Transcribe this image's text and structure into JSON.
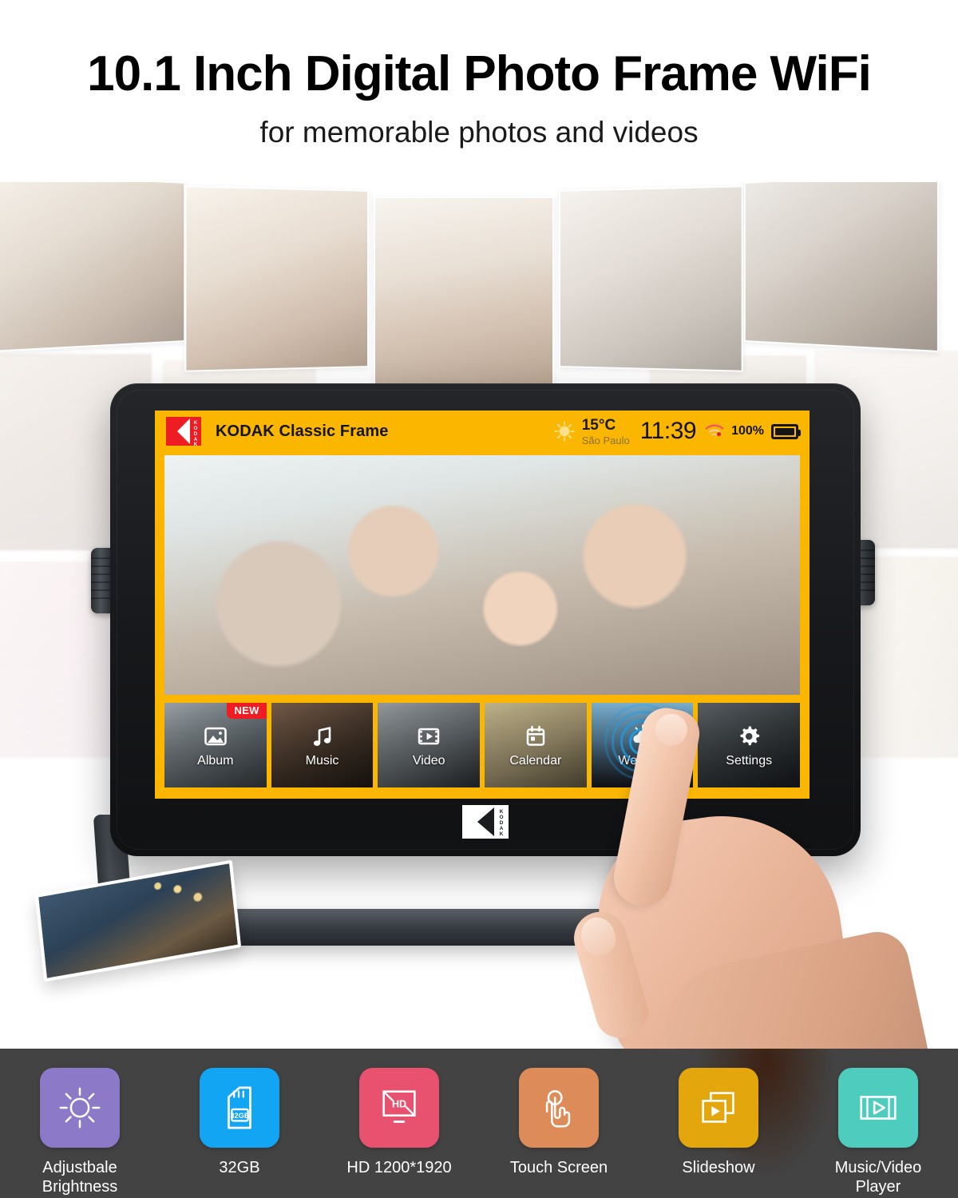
{
  "hero": {
    "title": "10.1 Inch Digital Photo Frame WiFi",
    "subtitle": "for memorable photos and videos"
  },
  "device": {
    "brand_logo_name": "kodak-logo",
    "chin_logo_name": "kodak-logo-white",
    "screen": {
      "statusbar": {
        "app_title": "KODAK Classic Frame",
        "weather": {
          "icon": "sun-icon",
          "temperature": "15°C",
          "location": "São Paulo"
        },
        "clock": "11:39",
        "wifi_icon": "wifi-icon",
        "battery_percent": "100%",
        "battery_icon": "battery-full-icon"
      },
      "apps": [
        {
          "label": "Album",
          "icon": "image-icon",
          "badge": "NEW"
        },
        {
          "label": "Music",
          "icon": "music-note-icon",
          "badge": ""
        },
        {
          "label": "Video",
          "icon": "film-play-icon",
          "badge": ""
        },
        {
          "label": "Calendar",
          "icon": "calendar-icon",
          "badge": ""
        },
        {
          "label": "Weather",
          "icon": "sun-cloud-icon",
          "badge": ""
        },
        {
          "label": "Settings",
          "icon": "gear-icon",
          "badge": ""
        }
      ]
    }
  },
  "footer": {
    "features": [
      {
        "label": "Adjustbale\nBrightness",
        "icon": "brightness-sun-icon",
        "color": "#8C7AC8"
      },
      {
        "label": "32GB",
        "icon": "sd-card-icon",
        "color": "#12A5F4"
      },
      {
        "label": "HD 1200*1920",
        "icon": "hd-monitor-icon",
        "color": "#E8526F"
      },
      {
        "label": "Touch Screen",
        "icon": "touch-hand-icon",
        "color": "#DD8B58"
      },
      {
        "label": "Slideshow",
        "icon": "slideshow-icon",
        "color": "#E3A60C"
      },
      {
        "label": "Music/Video\nPlayer",
        "icon": "film-play-icon",
        "color": "#4ECDBE"
      }
    ]
  },
  "colors": {
    "kodak_yellow": "#FBB600",
    "kodak_red": "#EE1D23",
    "footer_bg": "#434343",
    "bezel": "#1A1B1E",
    "ripple_blue": "#1C9FE8"
  }
}
